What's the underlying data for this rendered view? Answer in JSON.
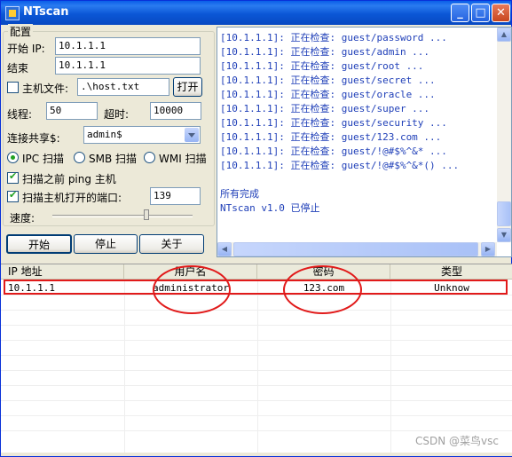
{
  "window": {
    "title": "NTscan",
    "min": "_",
    "max": "□",
    "close": "✕"
  },
  "config": {
    "group_label": "配置",
    "start_ip_label": "开始 IP:",
    "start_ip_value": "10.1.1.1",
    "end_label": "结束",
    "end_value": "10.1.1.1",
    "hostfile_label": "主机文件:",
    "hostfile_value": ".\\host.txt",
    "open_label": "打开",
    "threads_label": "线程:",
    "threads_value": "50",
    "timeout_label": "超时:",
    "timeout_value": "10000",
    "share_label": "连接共享$:",
    "share_value": "admin$",
    "scan_modes": [
      {
        "label": "IPC 扫描",
        "selected": true
      },
      {
        "label": "SMB 扫描",
        "selected": false
      },
      {
        "label": "WMI 扫描",
        "selected": false
      }
    ],
    "ping_label": "扫描之前 ping 主机",
    "ping_checked": true,
    "port_label": "扫描主机打开的端口:",
    "port_checked": true,
    "port_value": "139",
    "speed_label": "速度:",
    "speed_level": 0.68
  },
  "buttons": {
    "start": "开始",
    "stop": "停止",
    "about": "关于"
  },
  "log": {
    "lines": [
      "[10.1.1.1]: 正在检查: guest/password ...",
      "[10.1.1.1]: 正在检查: guest/admin ...",
      "[10.1.1.1]: 正在检查: guest/root ...",
      "[10.1.1.1]: 正在检查: guest/secret ...",
      "[10.1.1.1]: 正在检查: guest/oracle ...",
      "[10.1.1.1]: 正在检查: guest/super ...",
      "[10.1.1.1]: 正在检查: guest/security ...",
      "[10.1.1.1]: 正在检查: guest/123.com ...",
      "[10.1.1.1]: 正在检查: guest/!@#$%^&* ...",
      "[10.1.1.1]: 正在检查: guest/!@#$%^&*() ..."
    ],
    "done": "所有完成",
    "stopped": "NTscan v1.0 已停止"
  },
  "results": {
    "columns": [
      "IP 地址",
      "用户名",
      "密码",
      "类型"
    ],
    "rows": [
      {
        "ip": "10.1.1.1",
        "user": "administrator",
        "password": "123.com",
        "type": "Unknow"
      }
    ]
  },
  "annotation_color": "#e11a1a",
  "watermark": "CSDN @菜鸟vsc"
}
